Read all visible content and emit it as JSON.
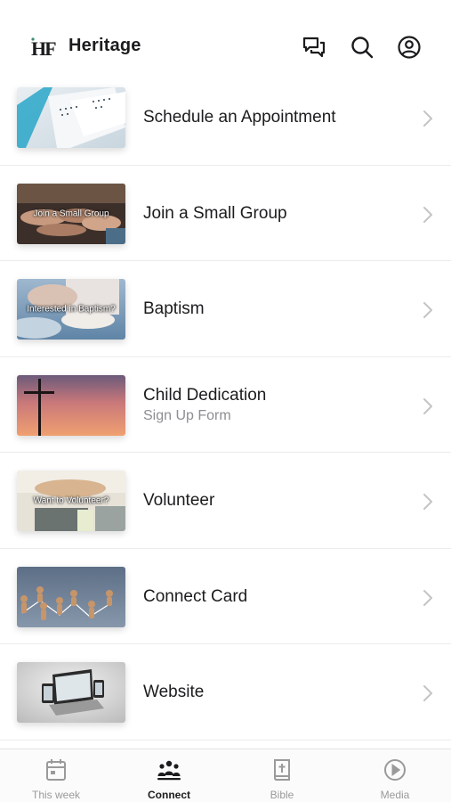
{
  "header": {
    "logo_text": "HF",
    "title": "Heritage",
    "icons": [
      "messages-icon",
      "search-icon",
      "profile-icon"
    ]
  },
  "items": [
    {
      "title": "Schedule an Appointment",
      "subtitle": "",
      "thumb_caption": "",
      "thumb_icon": "calendar-photo"
    },
    {
      "title": "Join a Small Group",
      "subtitle": "",
      "thumb_caption": "Join a Small Group",
      "thumb_icon": "hands-photo"
    },
    {
      "title": "Baptism",
      "subtitle": "",
      "thumb_caption": "Interested in Baptism?",
      "thumb_icon": "baptism-photo"
    },
    {
      "title": "Child Dedication",
      "subtitle": "Sign Up Form",
      "thumb_caption": "",
      "thumb_icon": "cross-sunset-photo"
    },
    {
      "title": "Volunteer",
      "subtitle": "",
      "thumb_caption": "Want to Volunteer?",
      "thumb_icon": "volunteer-photo"
    },
    {
      "title": "Connect Card",
      "subtitle": "",
      "thumb_caption": "",
      "thumb_icon": "network-figures-photo"
    },
    {
      "title": "Website",
      "subtitle": "",
      "thumb_caption": "",
      "thumb_icon": "devices-photo"
    }
  ],
  "tabs": [
    {
      "label": "This week",
      "icon": "calendar-icon",
      "active": false
    },
    {
      "label": "Connect",
      "icon": "people-icon",
      "active": true
    },
    {
      "label": "Bible",
      "icon": "bible-icon",
      "active": false
    },
    {
      "label": "Media",
      "icon": "play-icon",
      "active": false
    }
  ],
  "colors": {
    "text_primary": "#1c1c1e",
    "text_secondary": "#8e8e93",
    "tab_inactive": "#9a9a9a",
    "divider": "#ececec"
  }
}
